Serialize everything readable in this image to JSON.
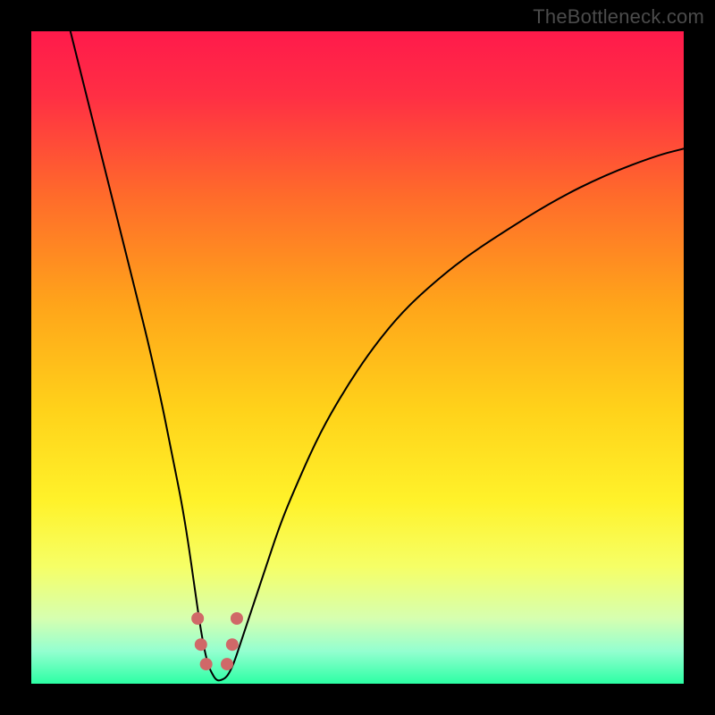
{
  "watermark": "TheBottleneck.com",
  "chart_data": {
    "type": "line",
    "title": "",
    "xlabel": "",
    "ylabel": "",
    "xlim": [
      0,
      100
    ],
    "ylim": [
      0,
      100
    ],
    "legend": false,
    "grid": false,
    "background_gradient": {
      "direction": "vertical",
      "stops": [
        {
          "offset": 0.0,
          "color": "#ff1a4b"
        },
        {
          "offset": 0.1,
          "color": "#ff2f44"
        },
        {
          "offset": 0.25,
          "color": "#ff6a2b"
        },
        {
          "offset": 0.42,
          "color": "#ffa51a"
        },
        {
          "offset": 0.58,
          "color": "#ffd21a"
        },
        {
          "offset": 0.72,
          "color": "#fff22a"
        },
        {
          "offset": 0.82,
          "color": "#f6ff66"
        },
        {
          "offset": 0.9,
          "color": "#d6ffb0"
        },
        {
          "offset": 0.95,
          "color": "#94ffd0"
        },
        {
          "offset": 1.0,
          "color": "#2cffa4"
        }
      ]
    },
    "series": [
      {
        "name": "curve",
        "color": "#000000",
        "stroke_width": 2,
        "x": [
          6,
          8,
          10,
          12,
          14,
          16,
          18,
          20,
          21,
          22,
          23,
          24,
          25,
          26,
          27,
          28,
          28.5,
          29,
          30,
          31,
          32,
          34,
          36,
          38,
          40,
          44,
          48,
          52,
          56,
          60,
          66,
          72,
          80,
          88,
          96,
          100
        ],
        "y": [
          100,
          92,
          84,
          76,
          68,
          60,
          52,
          43,
          38,
          33,
          28,
          22,
          15,
          8,
          3,
          1,
          0.5,
          0.5,
          1,
          3,
          6,
          12,
          18,
          24,
          29,
          38,
          45,
          51,
          56,
          60,
          65,
          69,
          74,
          78,
          81,
          82
        ]
      }
    ],
    "markers": {
      "name": "min-region",
      "color": "#d06868",
      "radius": 7,
      "points": [
        {
          "x": 25.5,
          "y": 10
        },
        {
          "x": 26.0,
          "y": 6
        },
        {
          "x": 26.8,
          "y": 3
        },
        {
          "x": 30.0,
          "y": 3
        },
        {
          "x": 30.8,
          "y": 6
        },
        {
          "x": 31.5,
          "y": 10
        }
      ]
    }
  }
}
